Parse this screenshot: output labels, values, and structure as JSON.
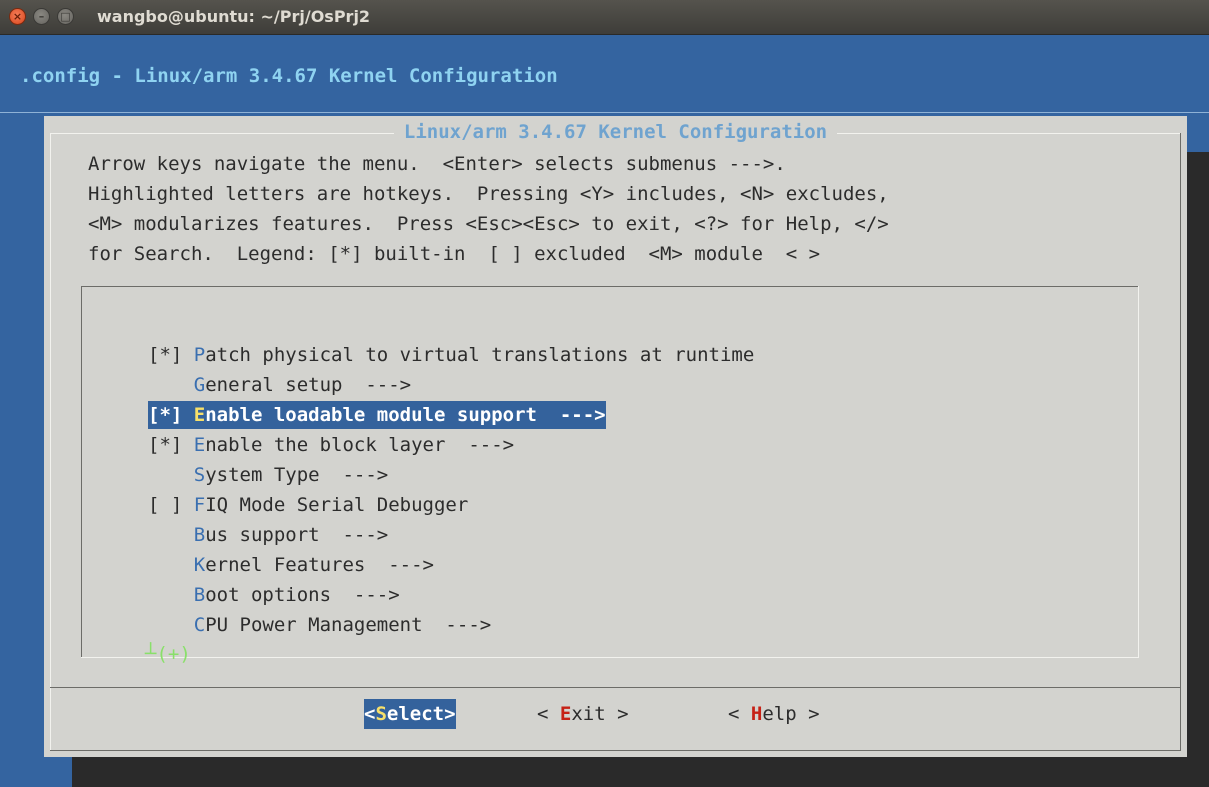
{
  "window": {
    "title": "wangbo@ubuntu: ~/Prj/OsPrj2",
    "close_glyph": "×",
    "minimize_glyph": "–",
    "maximize_glyph": "□"
  },
  "terminal": {
    "backtitle": ".config - Linux/arm 3.4.67 Kernel Configuration"
  },
  "dialog": {
    "title": "Linux/arm 3.4.67 Kernel Configuration",
    "help_lines": [
      "Arrow keys navigate the menu.  <Enter> selects submenus --->.",
      "Highlighted letters are hotkeys.  Pressing <Y> includes, <N> excludes,",
      "<M> modularizes features.  Press <Esc><Esc> to exit, <?> for Help, </>",
      "for Search.  Legend: [*] built-in  [ ] excluded  <M> module  < >"
    ],
    "menu_items": [
      {
        "prefix": "[*] ",
        "hot": "P",
        "rest": "atch physical to virtual translations at runtime"
      },
      {
        "prefix": "    ",
        "hot": "G",
        "rest": "eneral setup  --->"
      },
      {
        "prefix": "[*] ",
        "hot": "E",
        "rest": "nable loadable module support  --->"
      },
      {
        "prefix": "[*] ",
        "hot": "E",
        "rest": "nable the block layer  --->"
      },
      {
        "prefix": "    ",
        "hot": "S",
        "rest": "ystem Type  --->"
      },
      {
        "prefix": "[ ] ",
        "hot": "F",
        "rest": "IQ Mode Serial Debugger"
      },
      {
        "prefix": "    ",
        "hot": "B",
        "rest": "us support  --->"
      },
      {
        "prefix": "    ",
        "hot": "K",
        "rest": "ernel Features  --->"
      },
      {
        "prefix": "    ",
        "hot": "B",
        "rest": "oot options  --->"
      },
      {
        "prefix": "    ",
        "hot": "C",
        "rest": "PU Power Management  --->"
      }
    ],
    "selected_index": 2,
    "more_indicator": "┴(+)",
    "buttons": {
      "select": {
        "left": "<",
        "hot": "S",
        "rest": "elect>"
      },
      "exit": {
        "left": "< ",
        "hot": "E",
        "rest": "xit >"
      },
      "help": {
        "left": "< ",
        "hot": "H",
        "rest": "elp >"
      }
    }
  },
  "colors": {
    "terminal_bg": "#3464a0",
    "dialog_bg": "#d3d3cf",
    "hotkey": "#3a6fb0",
    "button_hotkey": "#c62116",
    "selected_hotkey": "#f7e06a"
  }
}
